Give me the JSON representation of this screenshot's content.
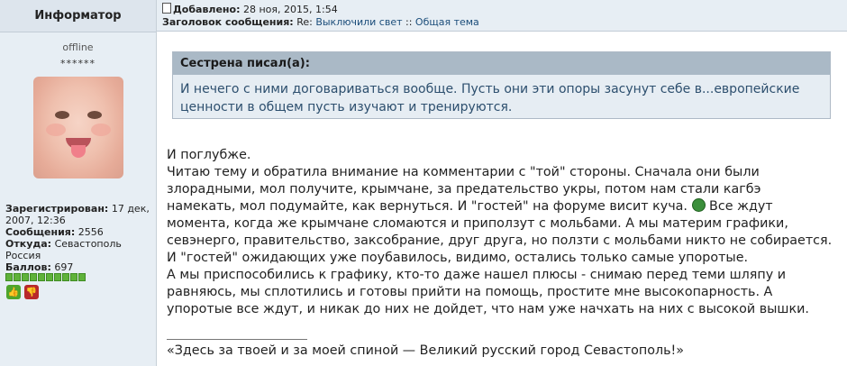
{
  "user": {
    "name": "Информатор",
    "status": "offline",
    "rank_stars": "******",
    "registered_label": "Зарегистрирован:",
    "registered_value": "17 дек, 2007, 12:36",
    "messages_label": "Сообщения:",
    "messages_value": "2556",
    "from_label": "Откуда:",
    "from_value": "Севастополь Россия",
    "points_label": "Баллов:",
    "points_value": "697"
  },
  "post": {
    "added_label": "Добавлено:",
    "added_value": "28 ноя, 2015, 1:54",
    "subject_label": "Заголовок сообщения:",
    "subject_prefix": "Re: ",
    "subject_topic": "Выключили свет",
    "subject_sep": " :: ",
    "subject_forum": "Общая тема"
  },
  "quote": {
    "author": "Сестрена писал(а):",
    "text": "И нечего с ними договариваться вообще. Пусть они эти опоры засунут себе в...европейские ценности в общем пусть изучают и тренируются."
  },
  "message": {
    "line1": "И поглубже.",
    "part_a": "Читаю тему и обратила внимание на комментарии с \"той\" стороны. Сначала они были злорадными, мол получите, крымчане, за предательство укры, потом нам стали кагбэ намекать, мол подумайте, как вернуться. И \"гостей\" на форуме висит куча. ",
    "part_b": " Все ждут момента, когда же крымчане сломаются и приползут с мольбами. А мы материм графики, севэнерго, правительство, заксобрание, друг друга, но ползти с мольбами никто не собирается.",
    "line3": "И \"гостей\" ожидающих уже поубавилось, видимо, остались только самые упоротые.",
    "line4": "А мы приспособились к графику, кто-то даже нашел плюсы - снимаю перед теми шляпу и равняюсь, мы сплотились и готовы прийти на помощь, простите мне высокопарность. А упоротые все ждут, и никак до них не дойдет, что нам уже начхать на них с высокой вышки."
  },
  "signature": "«Здесь за твоей и за моей спиной — Великий русский город Севастополь!»",
  "icons": {
    "post_icon": "document-icon",
    "smiley": "grin-smiley-icon",
    "vote_up": "thumbs-up-icon",
    "vote_down": "thumbs-down-icon"
  },
  "rating_bar": {
    "filled": 10,
    "total": 10
  },
  "colors": {
    "accent_green": "#5fb23a",
    "vote_down": "#b8282b",
    "quote_text": "#2d4f6e"
  }
}
